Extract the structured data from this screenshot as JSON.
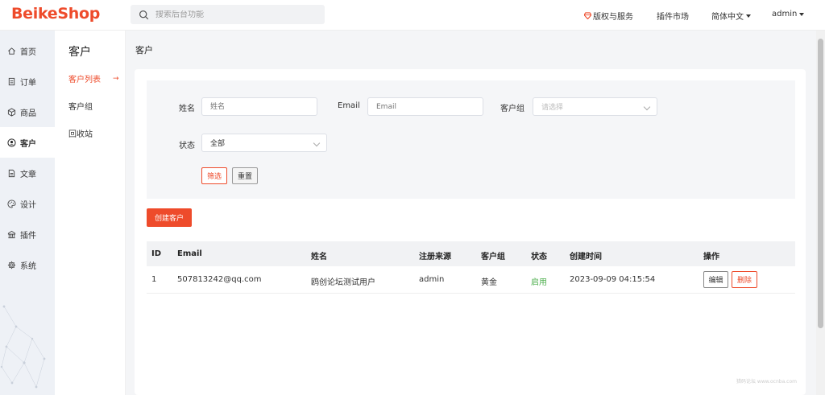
{
  "header": {
    "logo": "BeikeShop",
    "search_placeholder": "搜索后台功能",
    "copyright": "版权与服务",
    "plugin_market": "插件市场",
    "language": "简体中文",
    "user": "admin"
  },
  "sidebar": {
    "items": [
      {
        "label": "首页",
        "icon": "home-icon"
      },
      {
        "label": "订单",
        "icon": "order-icon"
      },
      {
        "label": "商品",
        "icon": "box-icon"
      },
      {
        "label": "客户",
        "icon": "user-icon",
        "active": true
      },
      {
        "label": "文章",
        "icon": "article-icon"
      },
      {
        "label": "设计",
        "icon": "palette-icon"
      },
      {
        "label": "插件",
        "icon": "plugin-icon"
      },
      {
        "label": "系统",
        "icon": "gear-icon"
      }
    ]
  },
  "subnav": {
    "title": "客户",
    "items": [
      {
        "label": "客户列表",
        "active": true
      },
      {
        "label": "客户组"
      },
      {
        "label": "回收站"
      }
    ]
  },
  "page": {
    "title": "客户"
  },
  "filter": {
    "name_label": "姓名",
    "name_placeholder": "姓名",
    "email_label": "Email",
    "email_placeholder": "Email",
    "group_label": "客户组",
    "group_placeholder": "请选择",
    "status_label": "状态",
    "status_value": "全部",
    "filter_button": "筛选",
    "reset_button": "重置"
  },
  "create_button": "创建客户",
  "table": {
    "headers": {
      "id": "ID",
      "email": "Email",
      "name": "姓名",
      "source": "注册来源",
      "group": "客户组",
      "status": "状态",
      "created": "创建时间",
      "actions": "操作"
    },
    "rows": [
      {
        "id": "1",
        "email": "507813242@qq.com",
        "name": "鸥创论坛测试用户",
        "source": "admin",
        "group": "黄金",
        "status": "启用",
        "created": "2023-09-09 04:15:54",
        "edit": "编辑",
        "delete": "删除"
      }
    ]
  },
  "watermark": "猎码论坛 www.ocnba.com",
  "colors": {
    "brand": "#ee4b2b",
    "status_enabled": "#4cae4c"
  }
}
